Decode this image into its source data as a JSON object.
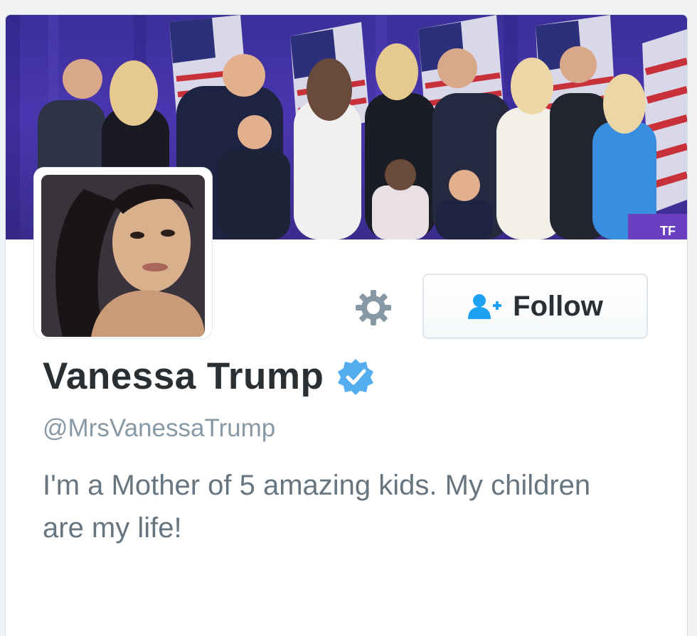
{
  "profile": {
    "display_name": "Vanessa Trump",
    "handle": "@MrsVanessaTrump",
    "bio": "I'm a Mother of 5 amazing kids. My children are my life!",
    "verified": true,
    "verified_icon": "verified-badge-icon"
  },
  "actions": {
    "follow_label": "Follow",
    "follow_icon": "add-user-icon",
    "settings_icon": "gear-icon"
  },
  "banner": {
    "corner_text": "TF"
  },
  "colors": {
    "accent": "#1da1f2",
    "verified": "#55acee",
    "name_text": "#292f33",
    "handle_text": "#8899a6",
    "bio_text": "#66757f"
  }
}
